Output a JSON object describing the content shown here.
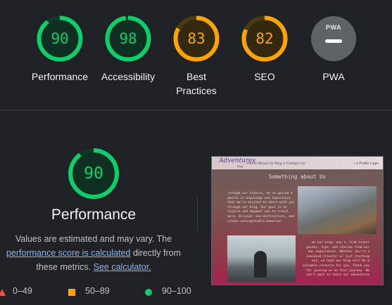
{
  "colors": {
    "pass": "#0cce6b",
    "average": "#ffa400",
    "fail": "#ff4e42",
    "pwa": "#5f6368"
  },
  "gauges": [
    {
      "score": "90",
      "label": "Performance",
      "level": 0.9,
      "color": "#0cce6b",
      "track": "#0d3a26",
      "fill": "#0f2f22"
    },
    {
      "score": "98",
      "label": "Accessibility",
      "level": 0.98,
      "color": "#0cce6b",
      "track": "#0d3a26",
      "fill": "#0f2f22"
    },
    {
      "score": "83",
      "label": "Best Practices",
      "level": 0.83,
      "color": "#ffa400",
      "track": "#4a3a10",
      "fill": "#33290f"
    },
    {
      "score": "82",
      "label": "SEO",
      "level": 0.82,
      "color": "#ffa400",
      "track": "#4a3a10",
      "fill": "#33290f"
    },
    {
      "badge": "PWA",
      "label": "PWA",
      "icon": "pwa-dash-icon"
    }
  ],
  "performance": {
    "score": "90",
    "level": 0.9,
    "title": "Performance",
    "desc_line1": "Values are estimated and may vary. The",
    "link1": "performance score is calculated",
    "desc_mid": " directly from",
    "desc_line3": "these metrics.",
    "link2": "See calculator."
  },
  "legend": [
    {
      "range": "0–49",
      "icon": "fail-triangle-icon",
      "color": "#ff4e42"
    },
    {
      "range": "50–89",
      "icon": "average-square-icon",
      "color": "#ffa400"
    },
    {
      "range": "90–100",
      "icon": "pass-circle-icon",
      "color": "#0cce6b"
    }
  ],
  "screenshot": {
    "logo": "Adventures",
    "logo_sub": "Blog",
    "nav": "Home   About Us   Blog ▾   Contact Us",
    "nav_right": "⌕ ▾  Profile  Login",
    "heading": "Something about Us",
    "para1": "Through our travels, we've gained a wealth of knowledge and experience that we're excited to share with you through our blog. Our goal is to inspire and empower you to travel more, discover new destinations, and create unforgettable memories",
    "para2": "On our blog, you'll find travel guides, tips, and stories from our own experiences. Whether you're a seasoned traveler or just starting out, we hope our blog will be a valuable resource for you. Thank you for joining us on this journey. We can't wait to share our adventures"
  }
}
